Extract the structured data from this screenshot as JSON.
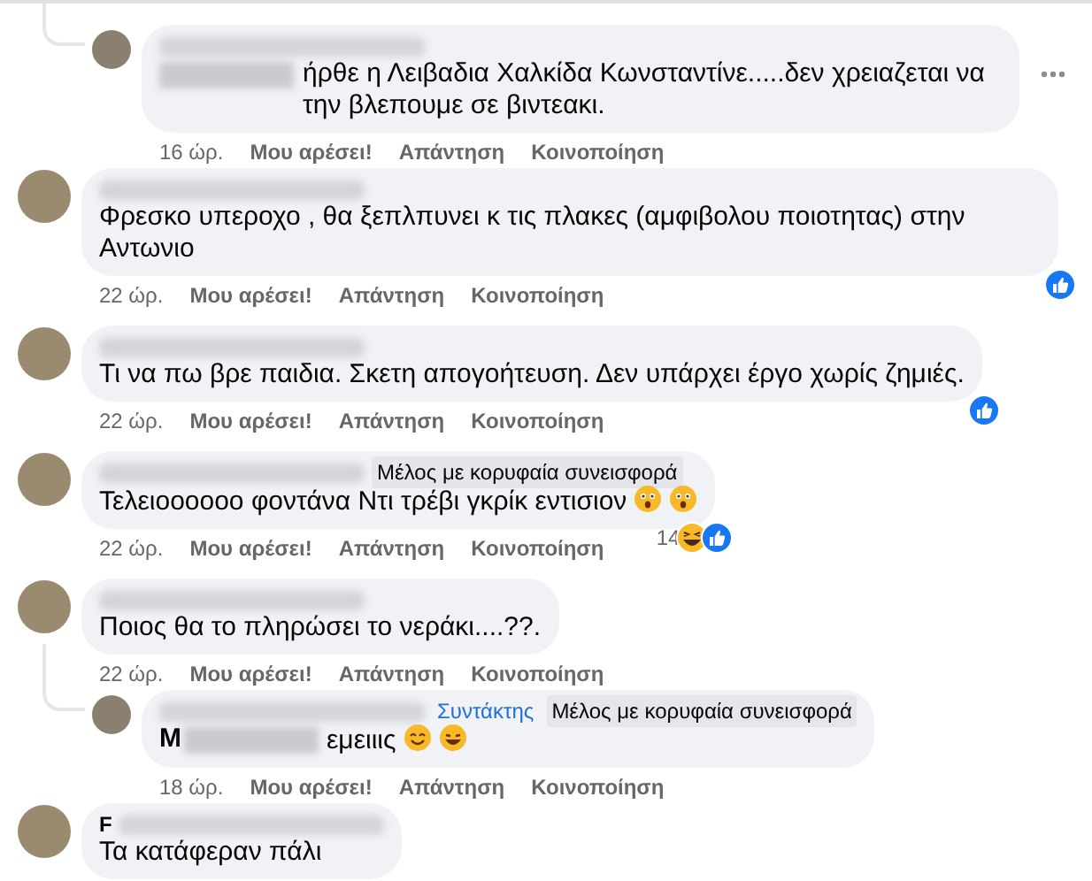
{
  "comments": [
    {
      "reply": true,
      "mention": true,
      "text": "ήρθε η Λειβαδια Χαλκίδα Κωνσταντίνε.....δεν χρειαζεται να την βλεπουμε σε βιντεακι.",
      "time": "16 ώρ.",
      "actions": [
        "Μου αρέσει!",
        "Απάντηση",
        "Κοινοποίηση"
      ],
      "more_menu": true
    },
    {
      "reply": false,
      "mention": false,
      "text": "Φρεσκο υπεροχο , θα ξεπλπυνει κ τις πλακες (αμφιβολου ποιοτητας) στην Αντωνιο",
      "time": "22 ώρ.",
      "actions": [
        "Μου αρέσει!",
        "Απάντηση",
        "Κοινοποίηση"
      ],
      "reactions": [
        {
          "kind": "like"
        }
      ],
      "more_menu": false
    },
    {
      "reply": false,
      "mention": false,
      "text": "Τι να πω βρε παιδια. Σκετη απογοήτευση. Δεν υπάρχει έργο χωρίς ζημιές.",
      "time": "22 ώρ.",
      "actions": [
        "Μου αρέσει!",
        "Απάντηση",
        "Κοινοποίηση"
      ],
      "reactions": [
        {
          "kind": "like"
        }
      ],
      "more_menu": false
    },
    {
      "reply": false,
      "mention": false,
      "badges": [
        {
          "kind": "member",
          "label": "Μέλος με κορυφαία συνεισφορά"
        }
      ],
      "text": "Τελειοοοοοο φοντάνα Ντι τρέβι γκρίκ εντισιον",
      "emojis": [
        {
          "kind": "astonished"
        },
        {
          "kind": "astonished"
        }
      ],
      "time": "22 ώρ.",
      "actions": [
        "Μου αρέσει!",
        "Απάντηση",
        "Κοινοποίηση"
      ],
      "reactions": [
        {
          "kind": "haha"
        },
        {
          "kind": "like"
        }
      ],
      "reaction_count": "14",
      "more_menu": false
    },
    {
      "reply": false,
      "mention": false,
      "text": "Ποιος θα το πληρώσει το νεράκι....??.",
      "time": "22 ώρ.",
      "actions": [
        "Μου αρέσει!",
        "Απάντηση",
        "Κοινοποίηση"
      ],
      "more_menu": false
    },
    {
      "reply": true,
      "mention": true,
      "mention_initial": "M",
      "badges": [
        {
          "kind": "author",
          "label": "Συντάκτης"
        },
        {
          "kind": "member",
          "label": "Μέλος με κορυφαία συνεισφορά"
        }
      ],
      "text": "εμειιις",
      "emojis": [
        {
          "kind": "smile"
        },
        {
          "kind": "joy"
        }
      ],
      "time": "18 ώρ.",
      "actions": [
        "Μου αρέσει!",
        "Απάντηση",
        "Κοινοποίηση"
      ],
      "more_menu": false
    },
    {
      "reply": false,
      "name_initial": "F",
      "mention": false,
      "text": "Τα κατάφεραν πάλι",
      "more_menu": false
    }
  ]
}
